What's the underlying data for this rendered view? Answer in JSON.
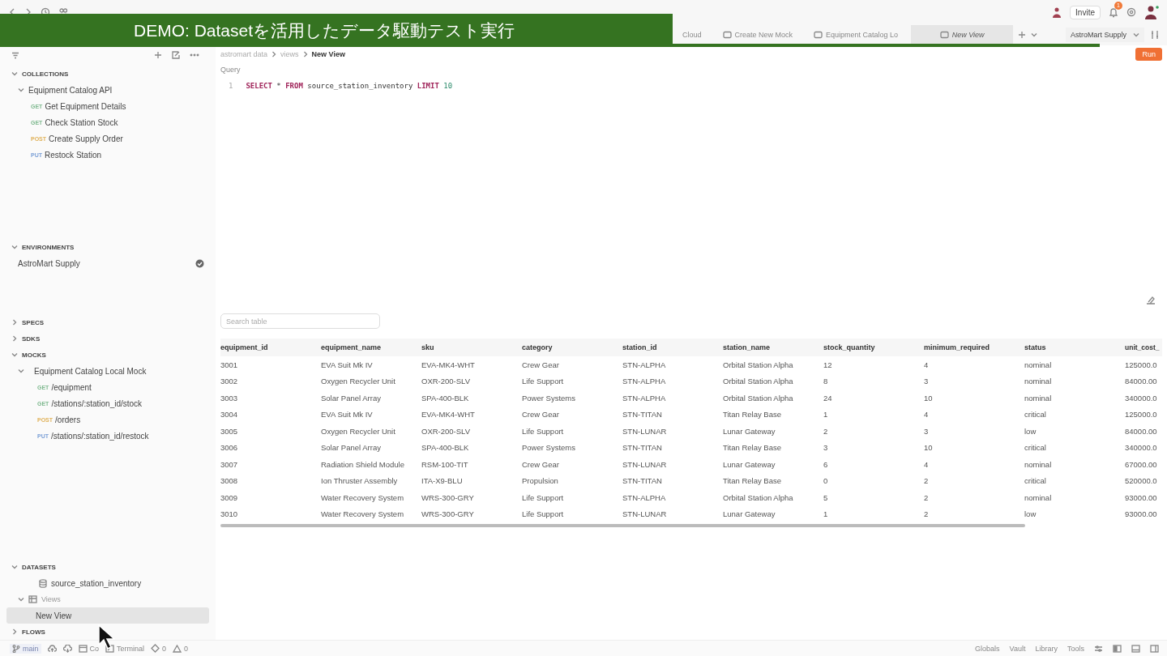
{
  "banner": {
    "text": "DEMO: Datasetを活用したデータ駆動テスト実行"
  },
  "titlebar": {
    "invite": "Invite",
    "notification_count": "1"
  },
  "tabs": [
    {
      "label": "Cloud",
      "selected": false
    },
    {
      "label": "Create New Mock",
      "selected": false
    },
    {
      "label": "Equipment Catalog Lo",
      "selected": false
    },
    {
      "label": "New View",
      "selected": true
    }
  ],
  "environment_select": "AstroMart Supply",
  "sidebar": {
    "sections": [
      {
        "title": "COLLECTIONS",
        "expanded": true,
        "items": [
          {
            "label": "Equipment Catalog API",
            "expanded": true,
            "children": [
              {
                "method": "GET",
                "color": "#7fb98f",
                "label": "Get Equipment Details"
              },
              {
                "method": "GET",
                "color": "#7fb98f",
                "label": "Check Station Stock"
              },
              {
                "method": "POST",
                "color": "#e0b25a",
                "label": "Create Supply Order"
              },
              {
                "method": "PUT",
                "color": "#7a9fd6",
                "label": "Restock Station"
              }
            ]
          }
        ]
      },
      {
        "title": "ENVIRONMENTS",
        "expanded": true,
        "items": [
          {
            "label": "AstroMart Supply",
            "active": true
          }
        ]
      },
      {
        "title": "SPECS",
        "expanded": false
      },
      {
        "title": "SDKS",
        "expanded": false
      },
      {
        "title": "MOCKS",
        "expanded": true,
        "items": [
          {
            "label": "Equipment Catalog Local Mock",
            "expanded": true,
            "children": [
              {
                "method": "GET",
                "color": "#7fb98f",
                "label": "/equipment"
              },
              {
                "method": "GET",
                "color": "#7fb98f",
                "label": "/stations/:station_id/stock"
              },
              {
                "method": "POST",
                "color": "#e0b25a",
                "label": "/orders"
              },
              {
                "method": "PUT",
                "color": "#7a9fd6",
                "label": "/stations/:station_id/restock"
              }
            ]
          }
        ]
      },
      {
        "title": "DATASETS",
        "expanded": true,
        "items": [
          {
            "kind": "dataset",
            "label": "source_station_inventory"
          },
          {
            "kind": "folder",
            "label": "Views",
            "expanded": true,
            "children": [
              {
                "label": "New View",
                "selected": true
              }
            ]
          }
        ]
      },
      {
        "title": "FLOWS",
        "expanded": false
      }
    ]
  },
  "breadcrumb": [
    "astromart data",
    "views",
    "New View"
  ],
  "run_button": "Run",
  "query": {
    "label": "Query",
    "line_number": "1",
    "tokens": [
      {
        "kind": "keyword",
        "text": "SELECT"
      },
      {
        "kind": "plain",
        "text": " * "
      },
      {
        "kind": "keyword",
        "text": "FROM"
      },
      {
        "kind": "plain",
        "text": " source_station_inventory "
      },
      {
        "kind": "keyword",
        "text": "LIMIT"
      },
      {
        "kind": "number",
        "text": " 10"
      }
    ]
  },
  "table": {
    "search": {
      "placeholder": "Search table"
    },
    "columns": [
      "equipment_id",
      "equipment_name",
      "sku",
      "category",
      "station_id",
      "station_name",
      "stock_quantity",
      "minimum_required",
      "status",
      "unit_cost_"
    ],
    "rows": [
      [
        "3001",
        "EVA Suit Mk IV",
        "EVA-MK4-WHT",
        "Crew Gear",
        "STN-ALPHA",
        "Orbital Station Alpha",
        "12",
        "4",
        "nominal",
        "125000.0"
      ],
      [
        "3002",
        "Oxygen Recycler Unit",
        "OXR-200-SLV",
        "Life Support",
        "STN-ALPHA",
        "Orbital Station Alpha",
        "8",
        "3",
        "nominal",
        "84000.00"
      ],
      [
        "3003",
        "Solar Panel Array",
        "SPA-400-BLK",
        "Power Systems",
        "STN-ALPHA",
        "Orbital Station Alpha",
        "24",
        "10",
        "nominal",
        "340000.0"
      ],
      [
        "3004",
        "EVA Suit Mk IV",
        "EVA-MK4-WHT",
        "Crew Gear",
        "STN-TITAN",
        "Titan Relay Base",
        "1",
        "4",
        "critical",
        "125000.0"
      ],
      [
        "3005",
        "Oxygen Recycler Unit",
        "OXR-200-SLV",
        "Life Support",
        "STN-LUNAR",
        "Lunar Gateway",
        "2",
        "3",
        "low",
        "84000.00"
      ],
      [
        "3006",
        "Solar Panel Array",
        "SPA-400-BLK",
        "Power Systems",
        "STN-TITAN",
        "Titan Relay Base",
        "3",
        "10",
        "critical",
        "340000.0"
      ],
      [
        "3007",
        "Radiation Shield Module",
        "RSM-100-TIT",
        "Crew Gear",
        "STN-LUNAR",
        "Lunar Gateway",
        "6",
        "4",
        "nominal",
        "67000.00"
      ],
      [
        "3008",
        "Ion Thruster Assembly",
        "ITA-X9-BLU",
        "Propulsion",
        "STN-TITAN",
        "Titan Relay Base",
        "0",
        "2",
        "critical",
        "520000.0"
      ],
      [
        "3009",
        "Water Recovery System",
        "WRS-300-GRY",
        "Life Support",
        "STN-ALPHA",
        "Orbital Station Alpha",
        "5",
        "2",
        "nominal",
        "93000.00"
      ],
      [
        "3010",
        "Water Recovery System",
        "WRS-300-GRY",
        "Life Support",
        "STN-LUNAR",
        "Lunar Gateway",
        "1",
        "2",
        "low",
        "93000.00"
      ]
    ]
  },
  "status_bar": {
    "branch": "main",
    "left": [
      "Co",
      "Terminal"
    ],
    "errors": "0",
    "warnings": "0",
    "right": [
      "Globals",
      "Vault",
      "Library",
      "Tools"
    ]
  }
}
